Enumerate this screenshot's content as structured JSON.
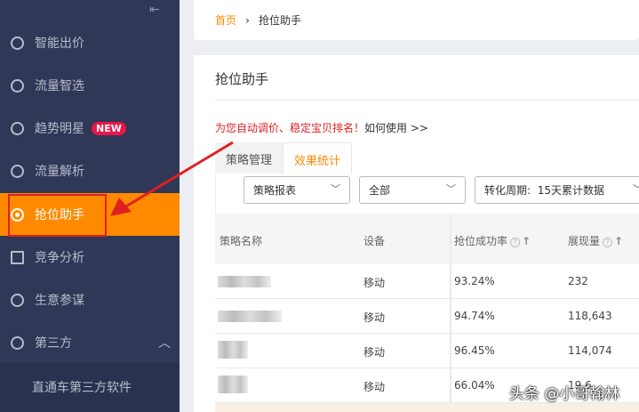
{
  "sidebar": {
    "items": [
      {
        "label": "智能出价",
        "icon": "pulse-icon"
      },
      {
        "label": "流量智选",
        "icon": "pulse-icon"
      },
      {
        "label": "趋势明星",
        "icon": "trend-icon",
        "badge": "NEW"
      },
      {
        "label": "流量解析",
        "icon": "trend-icon"
      },
      {
        "label": "抢位助手",
        "icon": "target-icon",
        "active": true
      },
      {
        "label": "竞争分析",
        "icon": "bar-chart-icon"
      },
      {
        "label": "生意参谋",
        "icon": "compass-icon"
      },
      {
        "label": "第三方",
        "icon": "refresh-icon",
        "expanded": true
      }
    ],
    "subitem": "直通车第三方软件"
  },
  "breadcrumb": {
    "home": "首页",
    "current": "抢位助手"
  },
  "page": {
    "title": "抢位助手",
    "tip_red": "为您自动调价、稳定宝贝排名！",
    "tip_link": "如何使用 >>"
  },
  "tabs": [
    "策略管理",
    "效果统计"
  ],
  "filters": {
    "report": "策略报表",
    "scope": "全部",
    "period_label": "转化周期:",
    "period": "15天累计数据"
  },
  "table": {
    "headers": [
      "策略名称",
      "设备",
      "抢位成功率",
      "展现量"
    ],
    "rows": [
      [
        "",
        "移动",
        "93.24%",
        "232"
      ],
      [
        "",
        "移动",
        "94.74%",
        "118,643"
      ],
      [
        "",
        "移动",
        "96.45%",
        "114,074"
      ],
      [
        "",
        "移动",
        "66.04%",
        "19,6"
      ]
    ]
  },
  "watermark": "头条 @小哥翰林",
  "colors": {
    "accent": "#ff8a00",
    "sidebar": "#2f3857",
    "annotation": "#e02020"
  }
}
